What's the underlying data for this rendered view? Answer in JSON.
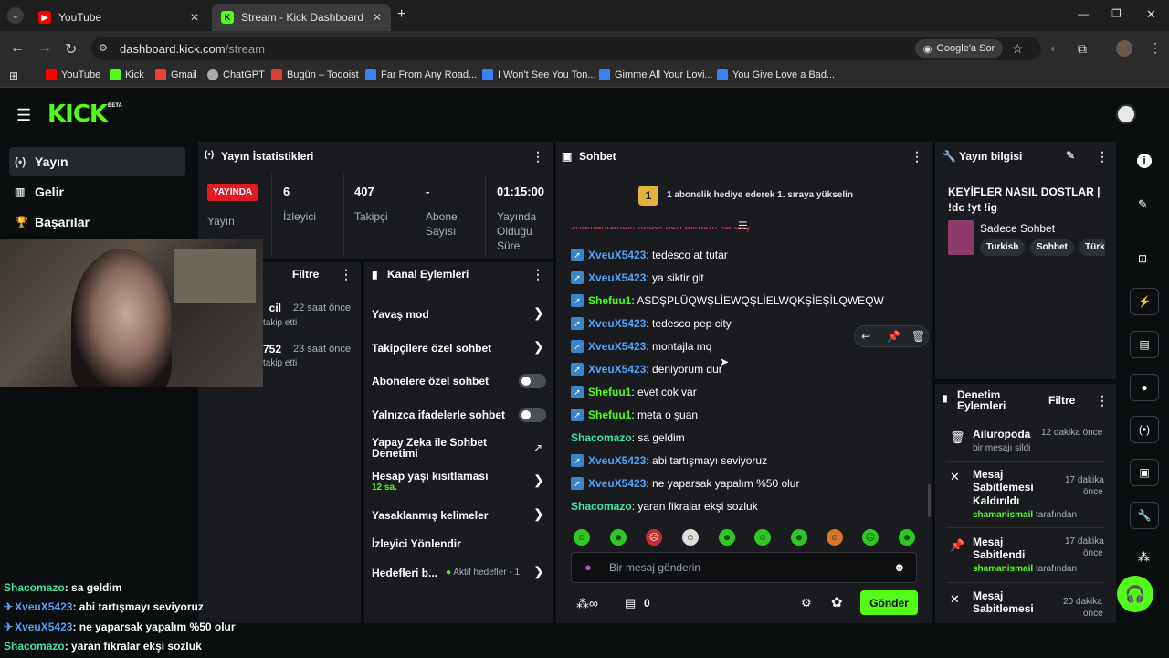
{
  "browser": {
    "tabs": [
      {
        "title": "YouTube",
        "icon": "youtube-icon",
        "active": false
      },
      {
        "title": "Stream - Kick Dashboard",
        "icon": "kick-icon",
        "active": true
      }
    ],
    "new_tab": "+",
    "url_host": "dashboard.kick.com",
    "url_path": "/stream",
    "ask_google": "Google'a Sor",
    "bookmarks": [
      "YouTube",
      "Kick",
      "Gmail",
      "ChatGPT",
      "Bugün – Todoist",
      "Far From Any Road...",
      "I Won't See You Ton...",
      "Gimme All Your Lovi...",
      "You Give Love a Bad..."
    ]
  },
  "kick": {
    "logo": "KICK",
    "beta": "BETA",
    "accent": "#53fc18"
  },
  "sidebar": {
    "items": [
      {
        "label": "Yayın",
        "icon": "broadcast-icon"
      },
      {
        "label": "Gelir",
        "icon": "revenue-icon"
      },
      {
        "label": "Başarılar",
        "icon": "trophy-icon"
      }
    ]
  },
  "stats": {
    "title": "Yayın İstatistikleri",
    "live_badge": "YAYINDA",
    "live_label": "Yayın",
    "viewers_value": "6",
    "viewers_label": "İzleyici",
    "followers_value": "407",
    "followers_label": "Takipçi",
    "subs_value": "-",
    "subs_label_1": "Abone",
    "subs_label_2": "Sayısı",
    "uptime_value": "01:15:00",
    "uptime_label_1": "Yayında",
    "uptime_label_2": "Olduğu",
    "uptime_label_3": "Süre"
  },
  "activity": {
    "filter": "Filtre",
    "items": [
      {
        "user": "_cil",
        "time": "22 saat önce",
        "action": "takip etti"
      },
      {
        "user": "752",
        "time": "23 saat önce",
        "action": "takip etti"
      }
    ]
  },
  "channel_actions": {
    "title": "Kanal Eylemleri",
    "items": [
      {
        "label": "Yavaş mod",
        "control": "chevron"
      },
      {
        "label": "Takipçilere özel sohbet",
        "control": "chevron"
      },
      {
        "label": "Abonelere özel sohbet",
        "control": "toggle",
        "value": "off"
      },
      {
        "label": "Yalnızca ifadelerle sohbet",
        "control": "toggle",
        "value": "off"
      },
      {
        "label": "Yapay Zeka ile Sohbet Denetimi",
        "control": "external"
      },
      {
        "label": "Hesap yaşı kısıtlaması",
        "sub": "12 sa.",
        "control": "chevron"
      },
      {
        "label": "Yasaklanmış kelimeler",
        "control": "chevron"
      },
      {
        "label": "İzleyici Yönlendir",
        "control": "none"
      },
      {
        "label": "Hedefleri b...",
        "sub": "Aktif hedefler - 1",
        "control": "chevron"
      }
    ]
  },
  "chat": {
    "title": "Sohbet",
    "gift_rank": "1",
    "gift_text": "1 abonelik hediye ederek 1. sıraya yükselin",
    "messages": [
      {
        "user": "XveuX5423",
        "color": "blue",
        "badge": true,
        "text": "tedesco at tutar"
      },
      {
        "user": "XveuX5423",
        "color": "blue",
        "badge": true,
        "text": "ya siktir git"
      },
      {
        "user": "Shefuu1",
        "color": "green",
        "badge": true,
        "text": "ASDŞPLÜQWŞLİEWQŞLİELWQKŞİEŞİLQWEQW"
      },
      {
        "user": "XveuX5423",
        "color": "blue",
        "badge": true,
        "text": "tedesco pep city"
      },
      {
        "user": "XveuX5423",
        "color": "blue",
        "badge": true,
        "text": "montajla mq"
      },
      {
        "user": "XveuX5423",
        "color": "blue",
        "badge": true,
        "text": "deniyorum dur"
      },
      {
        "user": "Shefuu1",
        "color": "green",
        "badge": true,
        "text": "evet cok var"
      },
      {
        "user": "Shefuu1",
        "color": "green",
        "badge": true,
        "text": "meta o şuan"
      },
      {
        "user": "Shacomazo",
        "color": "teal",
        "badge": false,
        "text": "sa geldim"
      },
      {
        "user": "XveuX5423",
        "color": "blue",
        "badge": true,
        "text": "abi tartışmayı seviyoruz"
      },
      {
        "user": "XveuX5423",
        "color": "blue",
        "badge": true,
        "text": "ne yaparsak yapalım %50 olur"
      },
      {
        "user": "Shacomazo",
        "color": "teal",
        "badge": false,
        "text": "yaran fikralar ekşi sozluk"
      }
    ],
    "input_placeholder": "Bir mesaj gönderin",
    "points_value": "0",
    "send_label": "Gönder"
  },
  "stream_info": {
    "title": "Yayın bilgisi",
    "stream_title_1": "KEYİFLER NASIL DOSTLAR |",
    "stream_title_2": "!dc !yt !ig",
    "category": "Sadece Sohbet",
    "tags": [
      "Turkish",
      "Sohbet",
      "Türk"
    ]
  },
  "mod_actions": {
    "title_1": "Denetim",
    "title_2": "Eylemleri",
    "filter": "Filtre",
    "items": [
      {
        "user": "Ailuropoda",
        "time": "12 dakika önce",
        "detail": "bir mesajı sildi",
        "icon": "trash-icon"
      },
      {
        "title_1": "Mesaj",
        "title_2": "Sabitlemesi",
        "title_3": "Kaldırıldı",
        "time_1": "17 dakika",
        "time_2": "önce",
        "by_user": "shamanismail",
        "by_suffix": "tarafından",
        "icon": "unpin-icon"
      },
      {
        "title_1": "Mesaj",
        "title_2": "Sabitlendi",
        "time_1": "17 dakika",
        "time_2": "önce",
        "by_user": "shamanismail",
        "by_suffix": "tarafından",
        "icon": "pin-icon"
      },
      {
        "title_1": "Mesaj",
        "title_2": "Sabitlemesi",
        "time_1": "20 dakika",
        "time_2": "önce",
        "icon": "unpin-icon"
      }
    ]
  },
  "overlay_chat": [
    {
      "user": "Shacomazo",
      "text": "sa geldim",
      "badge": false
    },
    {
      "user": "XveuX5423",
      "text": "abi tartışmayı seviyoruz",
      "badge": true
    },
    {
      "user": "XveuX5423",
      "text": "ne yaparsak yapalım %50 olur",
      "badge": true
    },
    {
      "user": "Shacomazo",
      "text": "yaran fikralar ekşi sozluk",
      "badge": false
    }
  ]
}
